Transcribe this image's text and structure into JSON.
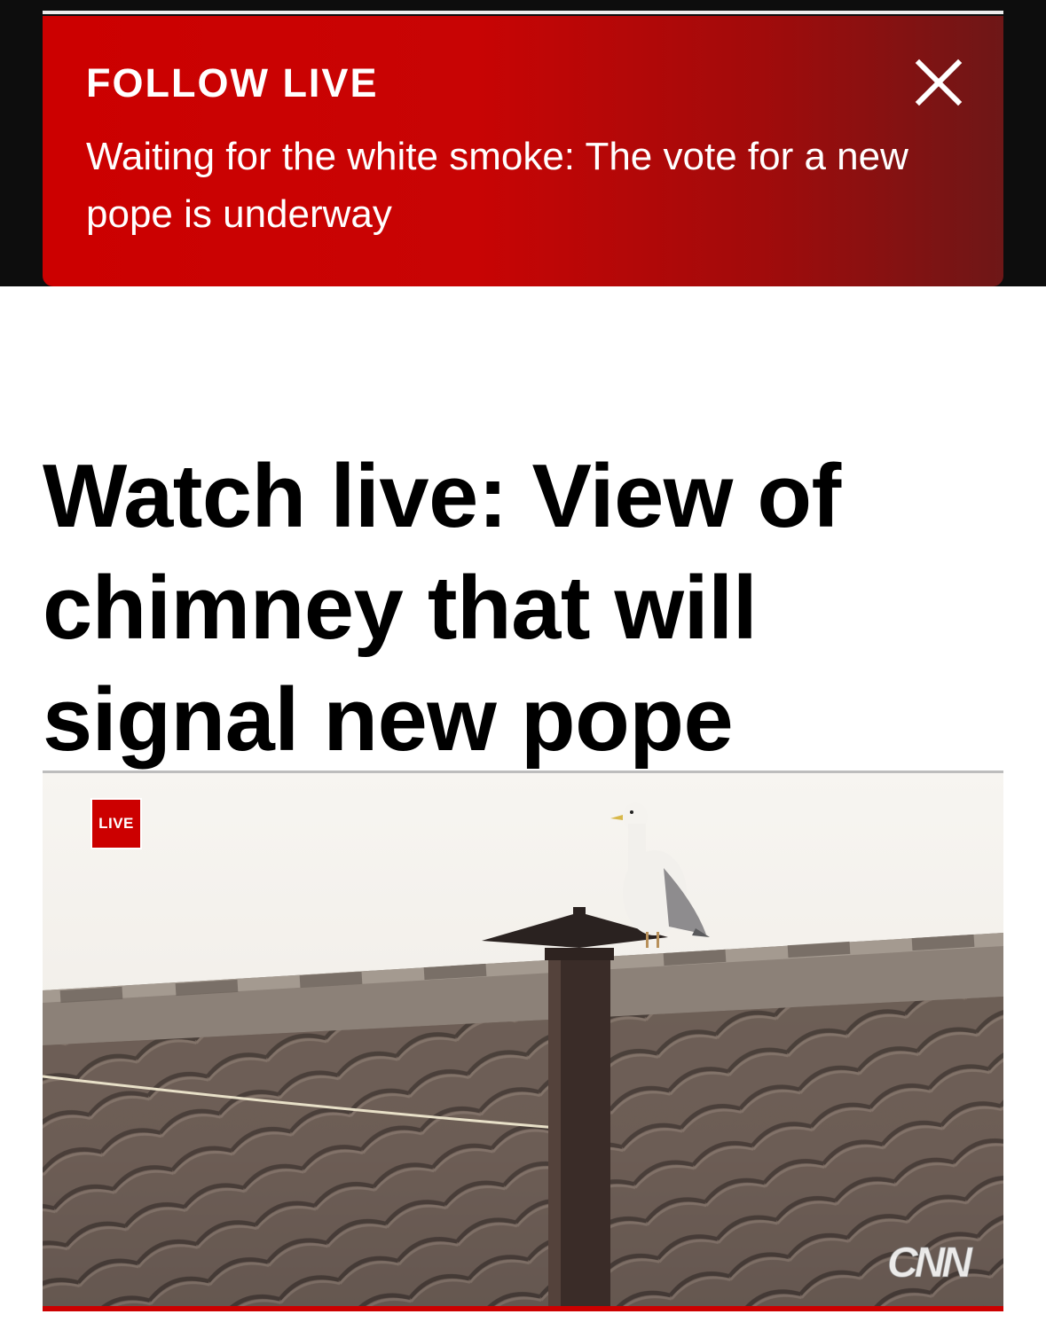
{
  "banner": {
    "label": "FOLLOW LIVE",
    "text": "Waiting for the white smoke: The vote for a new pope is underway",
    "close_icon": "close-icon"
  },
  "article": {
    "headline": "Watch live: View of chimney that will signal new pope"
  },
  "video": {
    "live_badge": "LIVE",
    "watermark": "CNN"
  },
  "colors": {
    "brand_red": "#cc0000",
    "background": "#ffffff",
    "top_band": "#0d0d0d"
  }
}
